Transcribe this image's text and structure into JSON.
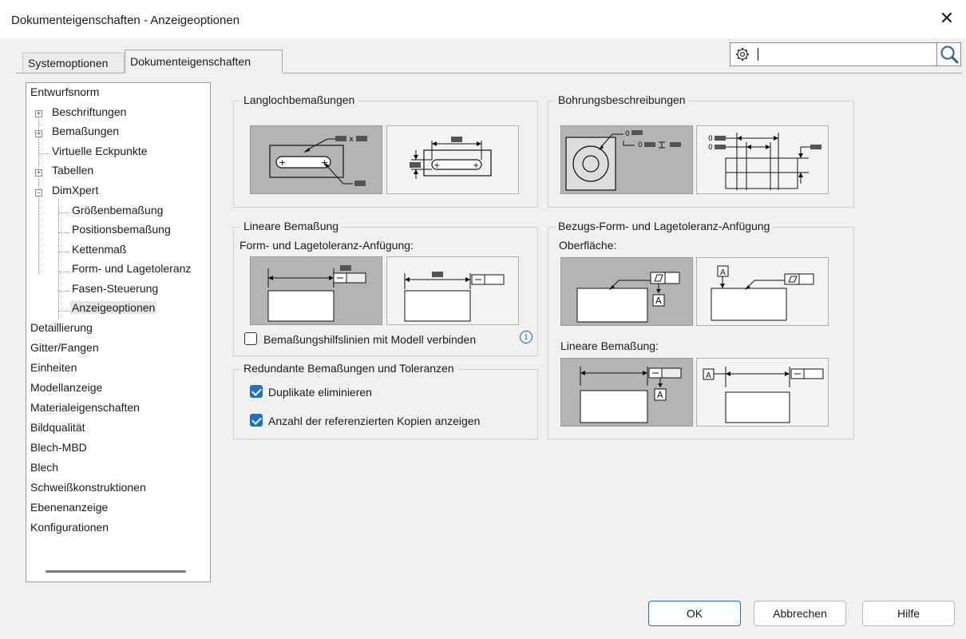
{
  "window": {
    "title": "Dokumenteigenschaften - Anzeigeoptionen",
    "close_glyph": "✕"
  },
  "tabs": [
    {
      "label": "Systemoptionen",
      "active": false
    },
    {
      "label": "Dokumenteigenschaften",
      "active": true
    }
  ],
  "search": {
    "value": "",
    "icon": "gear-icon",
    "button_icon": "search-icon"
  },
  "tree": {
    "expand_glyph": "+",
    "collapse_glyph": "−",
    "items": [
      {
        "label": "Entwurfsnorm",
        "level": 0
      },
      {
        "label": "Beschriftungen",
        "level": 1,
        "expander": "plus"
      },
      {
        "label": "Bemaßungen",
        "level": 1,
        "expander": "plus"
      },
      {
        "label": "Virtuelle Eckpunkte",
        "level": 1
      },
      {
        "label": "Tabellen",
        "level": 1,
        "expander": "plus"
      },
      {
        "label": "DimXpert",
        "level": 1,
        "expander": "minus"
      },
      {
        "label": "Größenbemaßung",
        "level": 2
      },
      {
        "label": "Positionsbemaßung",
        "level": 2
      },
      {
        "label": "Kettenmaß",
        "level": 2
      },
      {
        "label": "Form- und Lagetoleranz",
        "level": 2
      },
      {
        "label": "Fasen-Steuerung",
        "level": 2
      },
      {
        "label": "Anzeigeoptionen",
        "level": 2,
        "selected": true
      },
      {
        "label": "Detaillierung",
        "level": 0
      },
      {
        "label": "Gitter/Fangen",
        "level": 0
      },
      {
        "label": "Einheiten",
        "level": 0
      },
      {
        "label": "Modellanzeige",
        "level": 0
      },
      {
        "label": "Materialeigenschaften",
        "level": 0
      },
      {
        "label": "Bildqualität",
        "level": 0
      },
      {
        "label": "Blech-MBD",
        "level": 0
      },
      {
        "label": "Blech",
        "level": 0
      },
      {
        "label": "Schweißkonstruktionen",
        "level": 0
      },
      {
        "label": "Ebenenanzeige",
        "level": 0
      },
      {
        "label": "Konfigurationen",
        "level": 0
      }
    ]
  },
  "groups": {
    "slot": {
      "title": "Langlochbemaßungen",
      "selected_index": 0
    },
    "hole": {
      "title": "Bohrungsbeschreibungen",
      "selected_index": 0
    },
    "linear": {
      "title": "Lineare Bemaßung",
      "sublabel": "Form- und Lagetoleranz-Anfügung:",
      "selected_index": 0,
      "checkbox_label": "Bemaßungshilfslinien mit Modell verbinden",
      "checkbox_checked": false,
      "info_glyph": "i"
    },
    "redundant": {
      "title": "Redundante Bemaßungen und Toleranzen",
      "options": [
        {
          "label": "Duplikate eliminieren",
          "checked": true
        },
        {
          "label": "Anzahl der referenzierten Kopien anzeigen",
          "checked": true
        }
      ]
    },
    "datum": {
      "title": "Bezugs-Form- und Lagetoleranz-Anfügung",
      "surface_label": "Oberfläche:",
      "surface_selected_index": 0,
      "linear_label": "Lineare Bemaßung:",
      "linear_selected_index": 0
    }
  },
  "diagram_text": {
    "hole_depth_prefix": "0",
    "datum_letter": "A"
  },
  "buttons": {
    "ok": "OK",
    "cancel": "Abbrechen",
    "help": "Hilfe"
  }
}
